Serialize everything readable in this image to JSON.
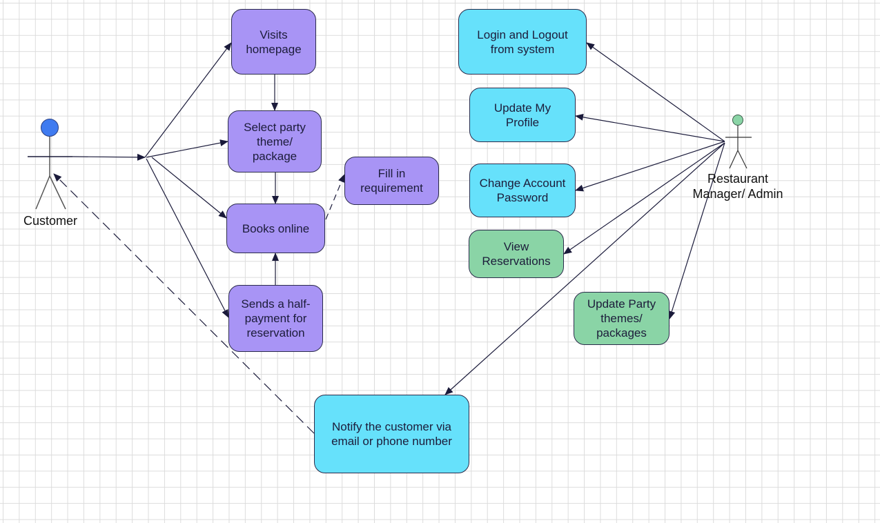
{
  "colors": {
    "customer_usecase": "#a894f5",
    "system_usecase": "#66e1fb",
    "admin_usecase": "#8ad4a6",
    "customer_head": "#3f7bf0",
    "admin_head": "#8ad4a6",
    "edge": "#1a1a3a"
  },
  "actors": {
    "customer": "Customer",
    "admin": "Restaurant\nManager/ Admin"
  },
  "use_cases": {
    "visits": "Visits\nhomepage",
    "select": "Select party\ntheme/\npackage",
    "books": "Books online",
    "sends": "Sends a half-\npayment for\nreservation",
    "fill": "Fill in\nrequirement",
    "login": "Login and Logout\nfrom system",
    "profile": "Update My\nProfile",
    "password": "Change Account\nPassword",
    "view": "View\nReservations",
    "update_party": "Update Party\nthemes/\npackages",
    "notify": "Notify the customer via\nemail or phone number"
  }
}
